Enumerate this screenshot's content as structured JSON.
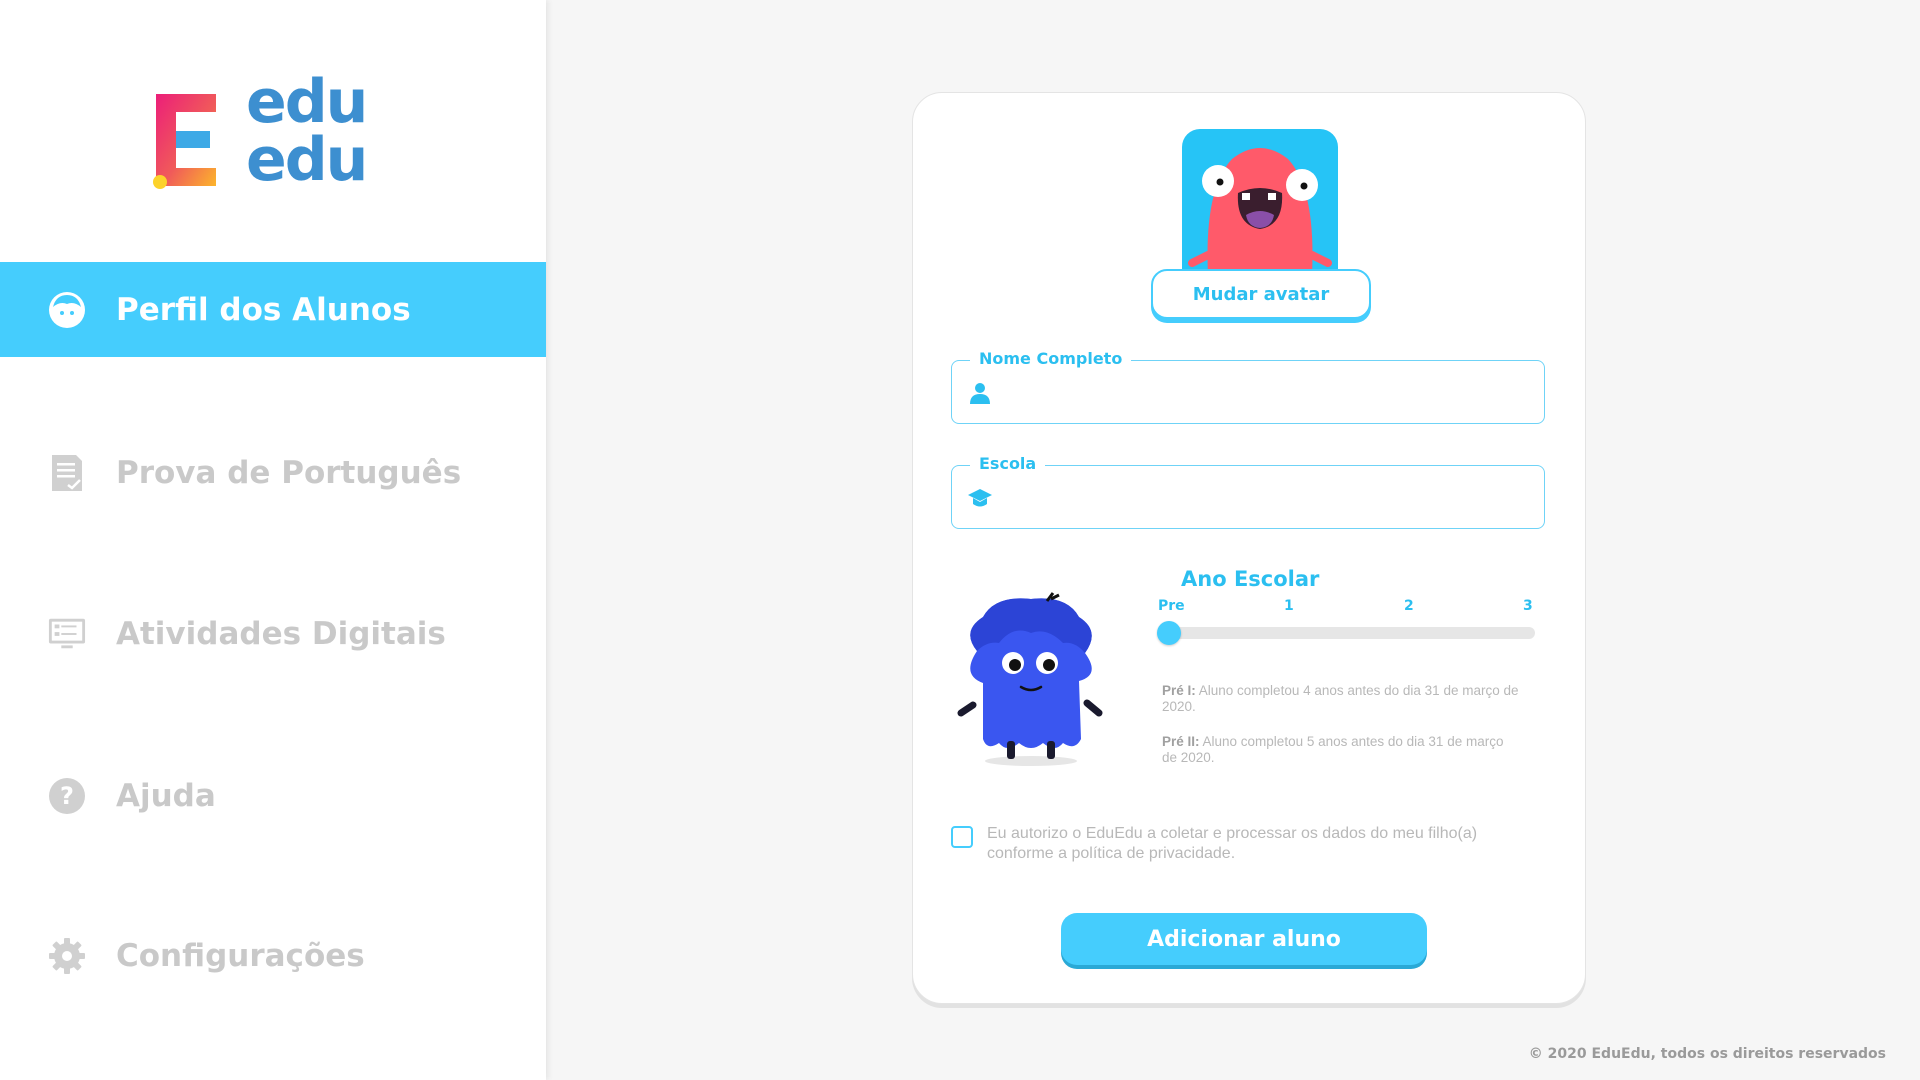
{
  "brand": {
    "logo_letter": "E",
    "logo_top": "edu",
    "logo_bottom": "edu"
  },
  "sidebar": {
    "items": [
      {
        "label": "Perfil dos Alunos",
        "icon": "child-face-icon",
        "active": true
      },
      {
        "label": "Prova de Português",
        "icon": "document-check-icon",
        "active": false
      },
      {
        "label": "Atividades Digitais",
        "icon": "monitor-checklist-icon",
        "active": false
      },
      {
        "label": "Ajuda",
        "icon": "help-question-icon",
        "active": false
      },
      {
        "label": "Configurações",
        "icon": "gear-icon",
        "active": false
      }
    ]
  },
  "form": {
    "avatar_button": "Mudar avatar",
    "name_field": {
      "label": "Nome Completo",
      "value": "",
      "icon": "person-icon"
    },
    "school_field": {
      "label": "Escola",
      "value": "",
      "icon": "graduation-cap-icon"
    },
    "grade": {
      "title": "Ano Escolar",
      "ticks": [
        "Pre",
        "1",
        "2",
        "3"
      ],
      "selected_index": 0,
      "notes": [
        {
          "bold": "Pré I:",
          "text": " Aluno completou 4 anos antes do dia 31 de março de 2020."
        },
        {
          "bold": "Pré II:",
          "text": " Aluno completou 5 anos antes do dia 31 de março de 2020."
        }
      ]
    },
    "consent_text": "Eu autorizo o EduEdu a coletar e processar os dados do meu filho(a) conforme a política de privacidade.",
    "consent_checked": false,
    "submit_label": "Adicionar aluno"
  },
  "footer": "© 2020 EduEdu, todos os direitos reservados",
  "colors": {
    "accent": "#45cdfd",
    "brand_blue": "#3d8fd0",
    "monster_red": "#ff5a6a",
    "mascot_blue": "#3a56f0"
  }
}
